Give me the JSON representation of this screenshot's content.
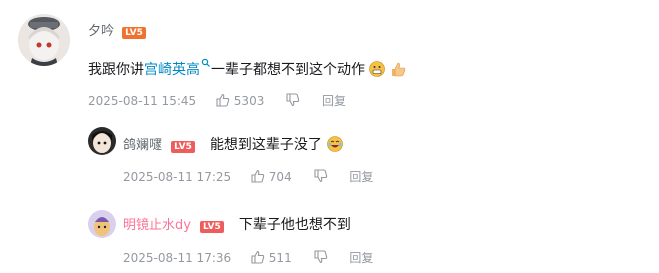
{
  "comment": {
    "username": "夕吟",
    "level": "LV5",
    "text_pre": "我跟你讲",
    "mention": "宫崎英高",
    "text_post": "一辈子都想不到这个动作",
    "date": "2025-08-11 15:45",
    "likes": "5303",
    "reply_label": "回复"
  },
  "replies": [
    {
      "username": "鸽斓嚺",
      "level": "LV5",
      "text": "能想到这辈子没了",
      "date": "2025-08-11 17:25",
      "likes": "704",
      "reply_label": "回复",
      "name_color": "#61666d"
    },
    {
      "username": "明镜止水dy",
      "level": "LV5",
      "text": "下辈子他也想不到",
      "date": "2025-08-11 17:36",
      "likes": "511",
      "reply_label": "回复",
      "name_color": "#fb7299"
    }
  ],
  "colors": {
    "link": "#008ac5",
    "level_badge": "#f0722f",
    "meta": "#9499a0"
  },
  "icons": [
    "search-link-icon",
    "grimace-emoji-icon",
    "thumbs-up-emoji-icon",
    "like-icon",
    "laugh-cry-emoji-icon"
  ]
}
